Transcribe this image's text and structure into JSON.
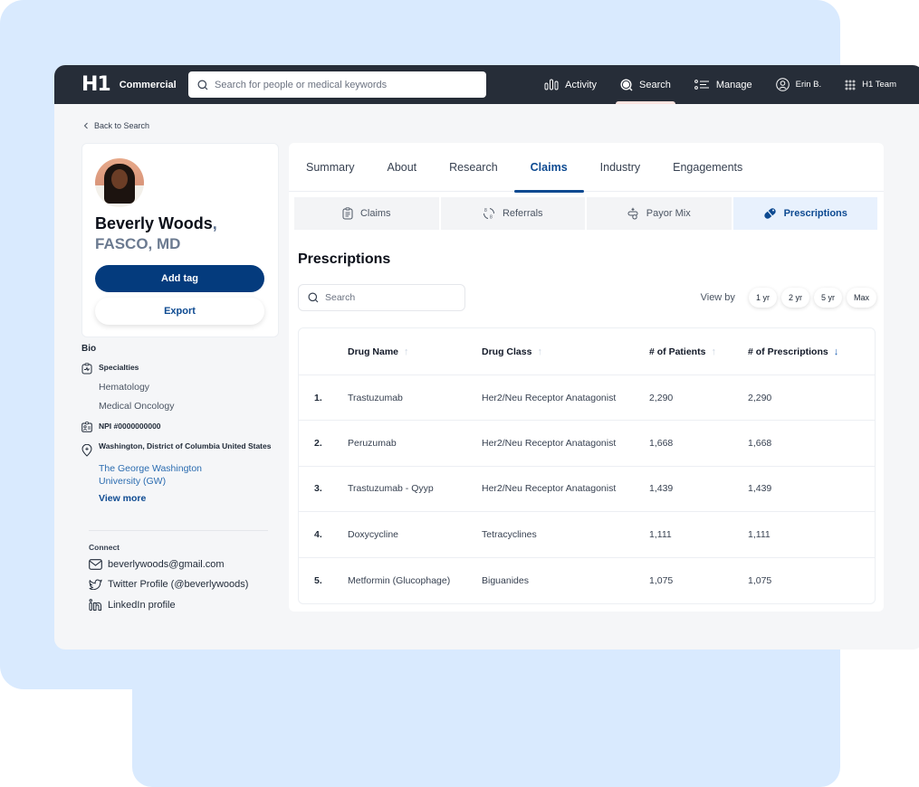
{
  "app": {
    "brand_mark": "H1",
    "brand_name": "Commercial",
    "search_placeholder": "Search for people or medical keywords",
    "nav": [
      {
        "label": "Activity",
        "icon": "activity-bars-icon",
        "active": false
      },
      {
        "label": "Search",
        "icon": "search-icon",
        "active": true
      },
      {
        "label": "Manage",
        "icon": "list-icon",
        "active": false
      },
      {
        "label": "Erin B.",
        "icon": "user-circle-icon",
        "active": false
      },
      {
        "label": "H1 Team",
        "icon": "grid-dots-icon",
        "active": false
      }
    ]
  },
  "back_link": "Back to Search",
  "profile": {
    "name": "Beverly Woods",
    "comma": ",",
    "credentials": "FASCO, MD",
    "add_tag_label": "Add tag",
    "export_label": "Export"
  },
  "bio": {
    "title": "Bio",
    "specialties_label": "Specialties",
    "specialties": [
      "Hematology",
      "Medical Oncology"
    ],
    "npi": "NPI #0000000000",
    "location": "Washington, District of Columbia United States",
    "institution": "The George Washington University (GW)",
    "view_more": "View more"
  },
  "connect": {
    "title": "Connect",
    "email": "beverlywoods@gmail.com",
    "twitter": "Twitter Profile (@beverlywoods)",
    "linkedin": "LinkedIn profile"
  },
  "tabs": [
    {
      "label": "Summary",
      "active": false
    },
    {
      "label": "About",
      "active": false
    },
    {
      "label": "Research",
      "active": false
    },
    {
      "label": "Claims",
      "active": true
    },
    {
      "label": "Industry",
      "active": false
    },
    {
      "label": "Engagements",
      "active": false
    }
  ],
  "subtabs": [
    {
      "label": "Claims",
      "icon": "clipboard-icon",
      "active": false
    },
    {
      "label": "Referrals",
      "icon": "referral-cycle-icon",
      "active": false
    },
    {
      "label": "Payor Mix",
      "icon": "payor-icon",
      "active": false
    },
    {
      "label": "Prescriptions",
      "icon": "pill-icon",
      "active": true
    }
  ],
  "prescriptions": {
    "title": "Prescriptions",
    "search_placeholder": "Search",
    "view_by_label": "View by",
    "ranges": [
      "1 yr",
      "2 yr",
      "5 yr",
      "Max"
    ],
    "columns": [
      {
        "label": "Drug Name",
        "sort": "asc",
        "sort_active": false
      },
      {
        "label": "Drug Class",
        "sort": "asc",
        "sort_active": false
      },
      {
        "label": "# of Patients",
        "sort": "asc",
        "sort_active": false
      },
      {
        "label": "# of Prescriptions",
        "sort": "desc",
        "sort_active": true
      }
    ],
    "rows": [
      {
        "rank": "1.",
        "drug": "Trastuzumab",
        "class": "Her2/Neu Receptor Anatagonist",
        "patients": "2,290",
        "prescriptions": "2,290"
      },
      {
        "rank": "2.",
        "drug": "Peruzumab",
        "class": "Her2/Neu Receptor Anatagonist",
        "patients": "1,668",
        "prescriptions": "1,668"
      },
      {
        "rank": "3.",
        "drug": "Trastuzumab - Qyyp",
        "class": "Her2/Neu Receptor Anatagonist",
        "patients": "1,439",
        "prescriptions": "1,439"
      },
      {
        "rank": "4.",
        "drug": "Doxycycline",
        "class": "Tetracyclines",
        "patients": "1,111",
        "prescriptions": "1,111"
      },
      {
        "rank": "5.",
        "drug": "Metformin (Glucophage)",
        "class": "Biguanides",
        "patients": "1,075",
        "prescriptions": "1,075"
      }
    ]
  },
  "colors": {
    "nav_bg": "#262d38",
    "primary": "#043b7d",
    "accent": "#0d4a91",
    "backdrop": "#d9eafe",
    "active_subtab": "#e8f1fd"
  }
}
